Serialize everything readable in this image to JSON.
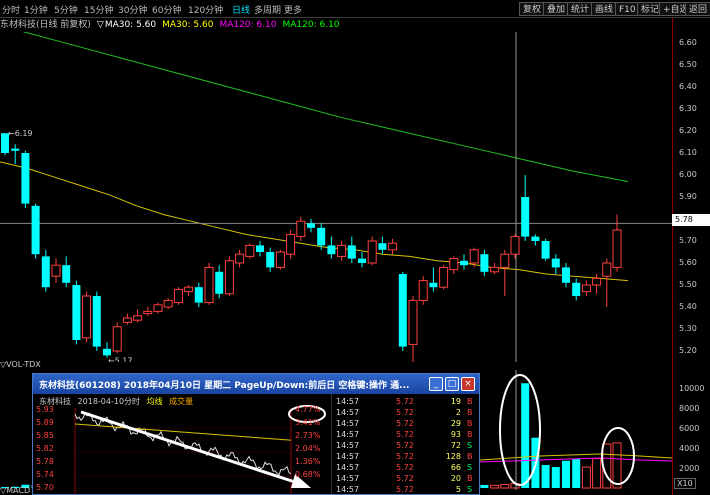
{
  "period_tabs": [
    "分时",
    "1分钟",
    "5分钟",
    "15分钟",
    "30分钟",
    "60分钟",
    "120分钟",
    "日线",
    "多周期",
    "更多"
  ],
  "active_period": "日线",
  "toolbar_buttons": [
    "复权",
    "叠加",
    "统计",
    "画线",
    "F10",
    "标记",
    "+自选",
    "返回"
  ],
  "stock_bar": {
    "name": "东材科技(日线 前复权)",
    "indicator": "▽",
    "ma30": "MA30: 5.60",
    "ma30b": "MA30: 5.60",
    "ma120": "MA120: 6.10",
    "ma120b": "MA120: 6.10",
    "colors": {
      "name": "#c0c0c0",
      "ma30": "#ffffff",
      "ma30b": "#ffff00",
      "ma120": "#ff00ff",
      "ma120b": "#00ff00"
    }
  },
  "y_axis": [
    "6.60",
    "6.50",
    "6.40",
    "6.30",
    "6.20",
    "6.10",
    "6.00",
    "5.90",
    "5.80",
    "5.70",
    "5.60",
    "5.50",
    "5.40",
    "5.30",
    "5.20"
  ],
  "current_price": "5.78",
  "high_marker": "6.19",
  "low_marker": "5.17",
  "vol_label": "▽VOL-TDX",
  "macd_label": "▽MACD",
  "vol_axis": [
    "10000",
    "8000",
    "6000",
    "4000",
    "2000"
  ],
  "vol_unit": "X10",
  "popup": {
    "title": "东材科技(601208) 2018年04月10日 星期二 PageUp/Down:前后日 空格键:操作 通...",
    "btn_min": "_",
    "btn_max": "□",
    "btn_close": "×",
    "mini_head": {
      "name": "东材科技",
      "date": "2018-04-10分时",
      "avg": "均线",
      "vol": "成交量"
    },
    "left_prices": [
      "5.93",
      "5.89",
      "5.85",
      "5.82",
      "5.78",
      "5.74",
      "5.70"
    ],
    "right_pcts": [
      "4.77%",
      "3.41%",
      "2.73%",
      "2.04%",
      "1.36%",
      "0.68%"
    ],
    "ticks": [
      {
        "t": "14:57",
        "p": "5.72",
        "v": "19",
        "s": "B"
      },
      {
        "t": "14:57",
        "p": "5.72",
        "v": "2",
        "s": "B"
      },
      {
        "t": "14:57",
        "p": "5.72",
        "v": "29",
        "s": "B"
      },
      {
        "t": "14:57",
        "p": "5.72",
        "v": "93",
        "s": "B"
      },
      {
        "t": "14:57",
        "p": "5.72",
        "v": "72",
        "s": "S"
      },
      {
        "t": "14:57",
        "p": "5.72",
        "v": "128",
        "s": "B"
      },
      {
        "t": "14:57",
        "p": "5.72",
        "v": "66",
        "s": "S"
      },
      {
        "t": "14:57",
        "p": "5.72",
        "v": "20",
        "s": "B"
      },
      {
        "t": "14:57",
        "p": "5.72",
        "v": "5",
        "s": "S"
      }
    ]
  },
  "candles": [
    {
      "o": 6.19,
      "h": 6.19,
      "l": 6.09,
      "c": 6.1
    },
    {
      "o": 6.12,
      "h": 6.14,
      "l": 6.05,
      "c": 6.11
    },
    {
      "o": 6.1,
      "h": 6.11,
      "l": 5.85,
      "c": 5.87
    },
    {
      "o": 5.86,
      "h": 5.87,
      "l": 5.62,
      "c": 5.64
    },
    {
      "o": 5.63,
      "h": 5.66,
      "l": 5.47,
      "c": 5.49
    },
    {
      "o": 5.54,
      "h": 5.62,
      "l": 5.51,
      "c": 5.59
    },
    {
      "o": 5.59,
      "h": 5.63,
      "l": 5.49,
      "c": 5.51
    },
    {
      "o": 5.5,
      "h": 5.52,
      "l": 5.23,
      "c": 5.25
    },
    {
      "o": 5.26,
      "h": 5.47,
      "l": 5.24,
      "c": 5.45
    },
    {
      "o": 5.45,
      "h": 5.47,
      "l": 5.2,
      "c": 5.22
    },
    {
      "o": 5.21,
      "h": 5.24,
      "l": 5.17,
      "c": 5.18
    },
    {
      "o": 5.2,
      "h": 5.33,
      "l": 5.19,
      "c": 5.31
    },
    {
      "o": 5.33,
      "h": 5.37,
      "l": 5.32,
      "c": 5.35
    },
    {
      "o": 5.34,
      "h": 5.39,
      "l": 5.33,
      "c": 5.36
    },
    {
      "o": 5.37,
      "h": 5.4,
      "l": 5.36,
      "c": 5.38
    },
    {
      "o": 5.38,
      "h": 5.42,
      "l": 5.37,
      "c": 5.41
    },
    {
      "o": 5.4,
      "h": 5.44,
      "l": 5.39,
      "c": 5.43
    },
    {
      "o": 5.42,
      "h": 5.49,
      "l": 5.41,
      "c": 5.48
    },
    {
      "o": 5.47,
      "h": 5.5,
      "l": 5.45,
      "c": 5.49
    },
    {
      "o": 5.49,
      "h": 5.51,
      "l": 5.4,
      "c": 5.42
    },
    {
      "o": 5.42,
      "h": 5.6,
      "l": 5.41,
      "c": 5.58
    },
    {
      "o": 5.56,
      "h": 5.59,
      "l": 5.44,
      "c": 5.46
    },
    {
      "o": 5.46,
      "h": 5.63,
      "l": 5.45,
      "c": 5.61
    },
    {
      "o": 5.6,
      "h": 5.66,
      "l": 5.58,
      "c": 5.64
    },
    {
      "o": 5.63,
      "h": 5.69,
      "l": 5.62,
      "c": 5.68
    },
    {
      "o": 5.68,
      "h": 5.7,
      "l": 5.63,
      "c": 5.65
    },
    {
      "o": 5.65,
      "h": 5.67,
      "l": 5.56,
      "c": 5.58
    },
    {
      "o": 5.58,
      "h": 5.66,
      "l": 5.57,
      "c": 5.65
    },
    {
      "o": 5.64,
      "h": 5.75,
      "l": 5.62,
      "c": 5.73
    },
    {
      "o": 5.72,
      "h": 5.81,
      "l": 5.7,
      "c": 5.79
    },
    {
      "o": 5.78,
      "h": 5.8,
      "l": 5.74,
      "c": 5.76
    },
    {
      "o": 5.76,
      "h": 5.78,
      "l": 5.66,
      "c": 5.68
    },
    {
      "o": 5.68,
      "h": 5.72,
      "l": 5.62,
      "c": 5.64
    },
    {
      "o": 5.63,
      "h": 5.7,
      "l": 5.61,
      "c": 5.68
    },
    {
      "o": 5.68,
      "h": 5.72,
      "l": 5.6,
      "c": 5.62
    },
    {
      "o": 5.62,
      "h": 5.65,
      "l": 5.58,
      "c": 5.6
    },
    {
      "o": 5.6,
      "h": 5.72,
      "l": 5.59,
      "c": 5.7
    },
    {
      "o": 5.69,
      "h": 5.72,
      "l": 5.64,
      "c": 5.66
    },
    {
      "o": 5.66,
      "h": 5.71,
      "l": 5.64,
      "c": 5.69
    },
    {
      "o": 5.55,
      "h": 5.56,
      "l": 5.2,
      "c": 5.22
    },
    {
      "o": 5.23,
      "h": 5.45,
      "l": 5.15,
      "c": 5.43
    },
    {
      "o": 5.43,
      "h": 5.54,
      "l": 5.41,
      "c": 5.52
    },
    {
      "o": 5.51,
      "h": 5.58,
      "l": 5.47,
      "c": 5.49
    },
    {
      "o": 5.49,
      "h": 5.59,
      "l": 5.48,
      "c": 5.58
    },
    {
      "o": 5.57,
      "h": 5.63,
      "l": 5.55,
      "c": 5.62
    },
    {
      "o": 5.61,
      "h": 5.64,
      "l": 5.57,
      "c": 5.59
    },
    {
      "o": 5.6,
      "h": 5.67,
      "l": 5.58,
      "c": 5.66
    },
    {
      "o": 5.64,
      "h": 5.66,
      "l": 5.54,
      "c": 5.56
    },
    {
      "o": 5.56,
      "h": 5.6,
      "l": 5.55,
      "c": 5.58
    },
    {
      "o": 5.58,
      "h": 5.66,
      "l": 5.45,
      "c": 5.64
    },
    {
      "o": 5.64,
      "h": 5.73,
      "l": 5.62,
      "c": 5.72
    },
    {
      "o": 5.9,
      "h": 6.0,
      "l": 5.7,
      "c": 5.72
    },
    {
      "o": 5.72,
      "h": 5.73,
      "l": 5.68,
      "c": 5.7
    },
    {
      "o": 5.7,
      "h": 5.71,
      "l": 5.61,
      "c": 5.62
    },
    {
      "o": 5.62,
      "h": 5.64,
      "l": 5.55,
      "c": 5.58
    },
    {
      "o": 5.58,
      "h": 5.6,
      "l": 5.49,
      "c": 5.51
    },
    {
      "o": 5.51,
      "h": 5.53,
      "l": 5.43,
      "c": 5.45
    },
    {
      "o": 5.47,
      "h": 5.52,
      "l": 5.45,
      "c": 5.5
    },
    {
      "o": 5.5,
      "h": 5.55,
      "l": 5.46,
      "c": 5.53
    },
    {
      "o": 5.54,
      "h": 5.62,
      "l": 5.4,
      "c": 5.6
    },
    {
      "o": 5.58,
      "h": 5.82,
      "l": 5.56,
      "c": 5.75
    }
  ],
  "volumes": [
    100,
    120,
    310,
    280,
    350,
    150,
    180,
    420,
    260,
    300,
    200,
    220,
    120,
    110,
    100,
    130,
    140,
    190,
    150,
    160,
    230,
    200,
    260,
    220,
    250,
    210,
    190,
    240,
    300,
    320,
    240,
    200,
    230,
    210,
    190,
    250,
    220,
    230,
    260,
    800,
    560,
    420,
    300,
    340,
    380,
    300,
    330,
    290,
    260,
    330,
    420,
    10000,
    4800,
    2200,
    2000,
    2600,
    2800,
    2000,
    2800,
    4200,
    4300
  ],
  "ma30_line": [
    6.06,
    6.03,
    5.99,
    5.95,
    5.91,
    5.86,
    5.82,
    5.79,
    5.76,
    5.73,
    5.71,
    5.69,
    5.67,
    5.66,
    5.64,
    5.63,
    5.61,
    5.6,
    5.58,
    5.57,
    5.55,
    5.54,
    5.53,
    5.52
  ],
  "ma120_line": [
    6.68,
    6.61,
    6.54,
    6.47,
    6.4,
    6.33,
    6.26,
    6.2,
    6.14,
    6.08,
    6.02,
    5.97
  ]
}
